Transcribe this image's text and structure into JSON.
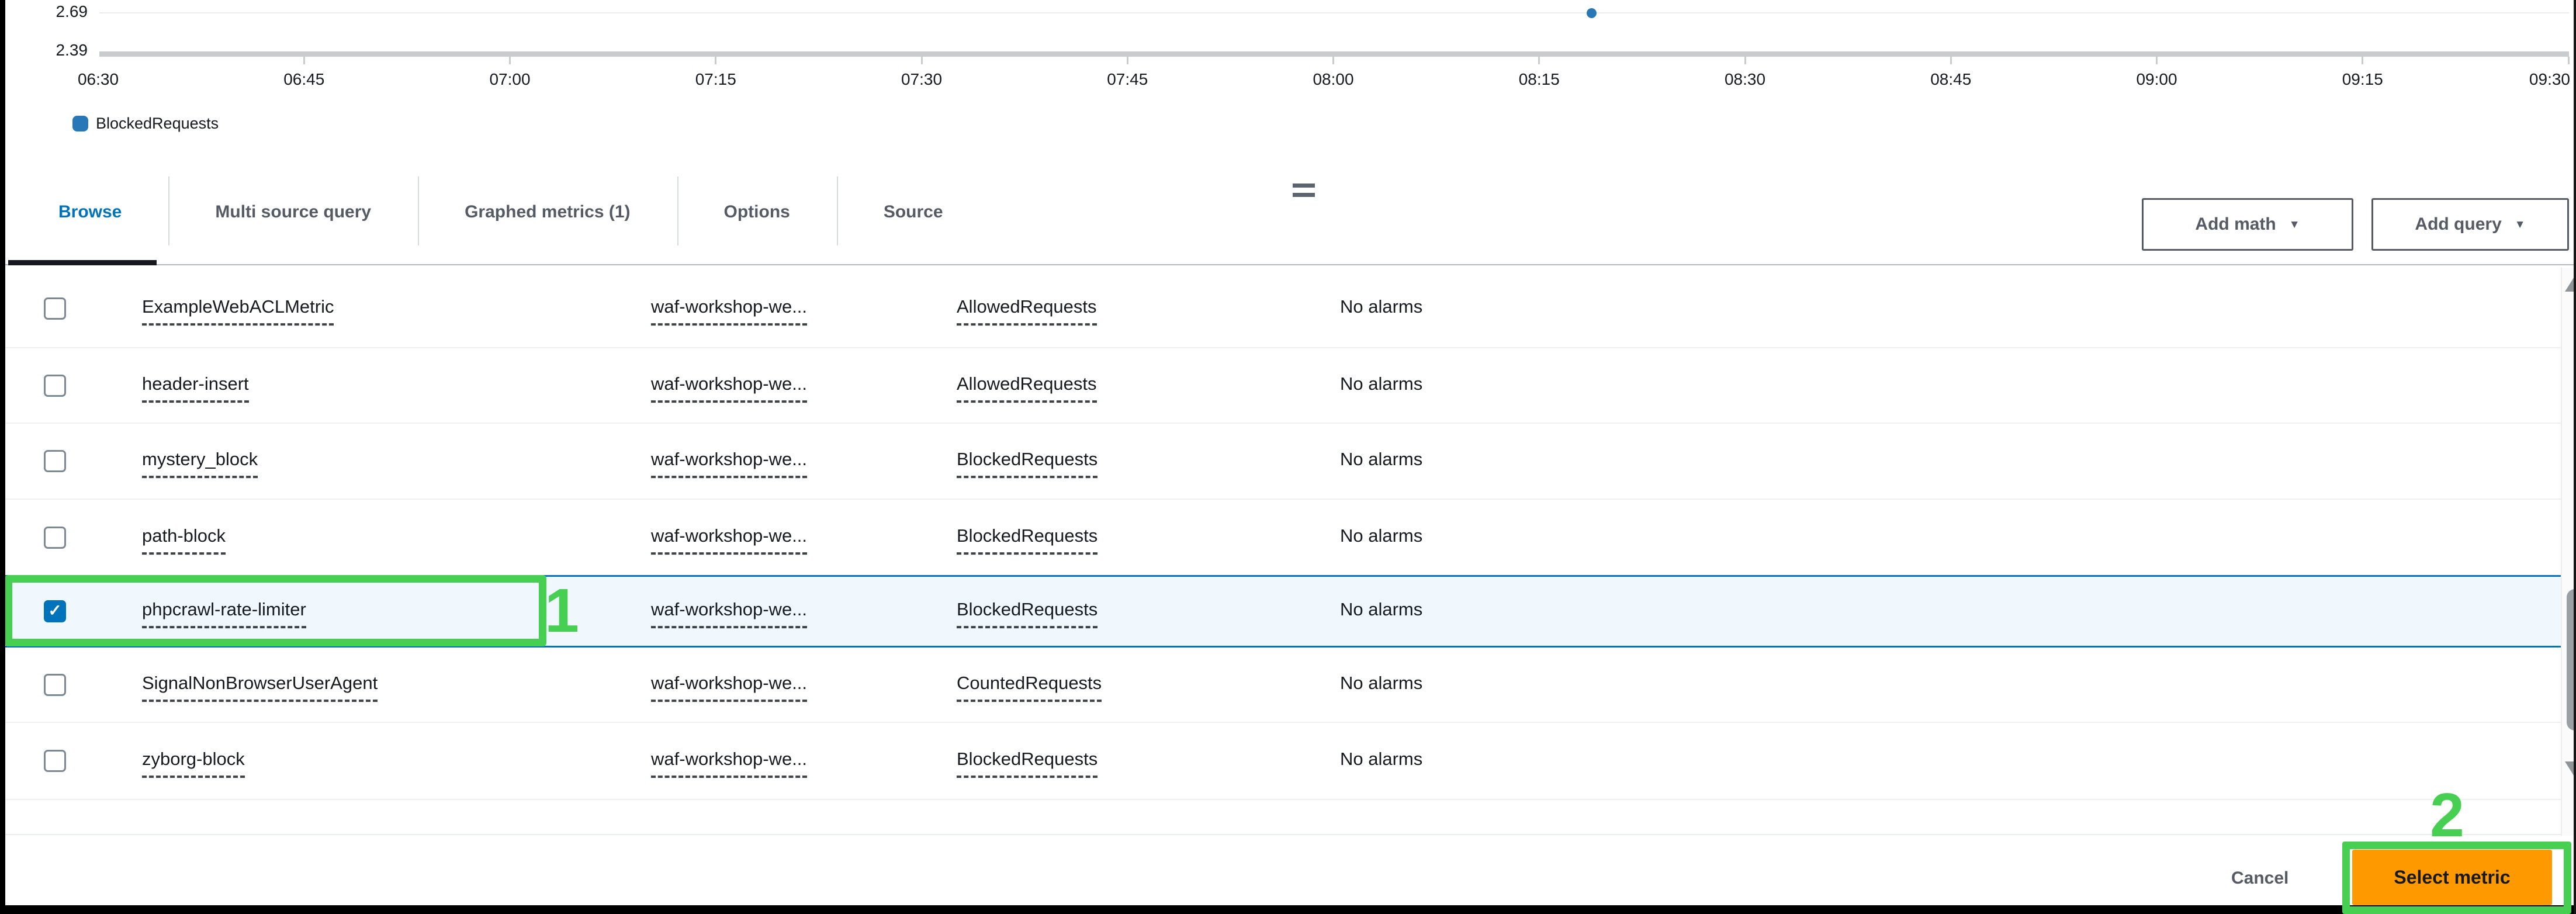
{
  "chart_data": {
    "type": "line",
    "title": "",
    "xlabel": "",
    "ylabel": "",
    "x_ticks": [
      "06:30",
      "06:45",
      "07:00",
      "07:15",
      "07:30",
      "07:45",
      "08:00",
      "08:15",
      "08:30",
      "08:45",
      "09:00",
      "09:15",
      "09:30"
    ],
    "y_ticks": [
      "2.69",
      "2.39"
    ],
    "ylim": [
      2.39,
      2.69
    ],
    "grid": true,
    "legend_position": "bottom-left",
    "series": [
      {
        "name": "BlockedRequests",
        "color": "#2878b8",
        "points": [
          {
            "x": "08:20",
            "y": 2.69
          }
        ]
      }
    ]
  },
  "tabs": [
    {
      "label": "Browse",
      "active": true
    },
    {
      "label": "Multi source query",
      "active": false
    },
    {
      "label": "Graphed metrics (1)",
      "active": false
    },
    {
      "label": "Options",
      "active": false
    },
    {
      "label": "Source",
      "active": false
    }
  ],
  "toolbar": {
    "add_math": {
      "label": "Add math",
      "caret": "▼"
    },
    "add_query": {
      "label": "Add query",
      "caret": "▼"
    }
  },
  "metrics_table": {
    "rows": [
      {
        "metric_name": "ExampleWebACLMetric",
        "dimension": "waf-workshop-we...",
        "statistic": "AllowedRequests",
        "alarms": "No alarms",
        "checked": false,
        "selected": false
      },
      {
        "metric_name": "header-insert",
        "dimension": "waf-workshop-we...",
        "statistic": "AllowedRequests",
        "alarms": "No alarms",
        "checked": false,
        "selected": false
      },
      {
        "metric_name": "mystery_block",
        "dimension": "waf-workshop-we...",
        "statistic": "BlockedRequests",
        "alarms": "No alarms",
        "checked": false,
        "selected": false
      },
      {
        "metric_name": "path-block",
        "dimension": "waf-workshop-we...",
        "statistic": "BlockedRequests",
        "alarms": "No alarms",
        "checked": false,
        "selected": false
      },
      {
        "metric_name": "phpcrawl-rate-limiter",
        "dimension": "waf-workshop-we...",
        "statistic": "BlockedRequests",
        "alarms": "No alarms",
        "checked": true,
        "selected": true
      },
      {
        "metric_name": "SignalNonBrowserUserAgent",
        "dimension": "waf-workshop-we...",
        "statistic": "CountedRequests",
        "alarms": "No alarms",
        "checked": false,
        "selected": false
      },
      {
        "metric_name": "zyborg-block",
        "dimension": "waf-workshop-we...",
        "statistic": "BlockedRequests",
        "alarms": "No alarms",
        "checked": false,
        "selected": false
      }
    ]
  },
  "footer": {
    "cancel_label": "Cancel",
    "select_metric_label": "Select metric"
  },
  "annotations": {
    "step_1": "1",
    "step_2": "2",
    "highlight_color": "#46cf51"
  },
  "colors": {
    "accent_blue": "#0073bb",
    "primary_orange": "#ff9900",
    "selected_row_bg": "#f0f8fd",
    "series_blue": "#2878b8",
    "annotation_green": "#46cf51"
  }
}
